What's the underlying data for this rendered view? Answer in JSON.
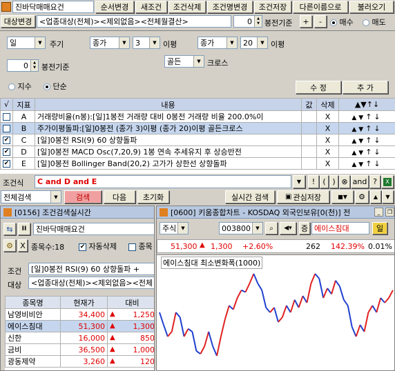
{
  "top": {
    "title_field": "진바닥매매요건",
    "buttons": [
      "순서변경",
      "새조건",
      "조건삭제",
      "조건명변경",
      "조건저장",
      "다른이름으로",
      "불러오기"
    ]
  },
  "target": {
    "label": "대상변경",
    "value": "<업종대상(전체)><제외없음><전체월결산>",
    "bong": "0",
    "bong_label": "봉전기준",
    "plus": "+",
    "minus": "-",
    "buy": "매수",
    "sell": "매도"
  },
  "settings": {
    "period": "일",
    "period_label": "주기",
    "bong": "0",
    "bong_label": "봉전기준",
    "jisu": "지수",
    "danseon": "단순",
    "ma1_type": "종가",
    "ma1_val": "3",
    "ma1_unit": "이평",
    "ma2_type": "종가",
    "ma2_val": "20",
    "ma2_unit": "이평",
    "cross_type": "골든",
    "cross_label": "크로스",
    "edit_btn": "수 정",
    "add_btn": "추 가"
  },
  "grid": {
    "headers": [
      "√",
      "지표",
      "내용",
      "값",
      "삭제",
      "▲▼↑↓"
    ],
    "rows": [
      {
        "checked": false,
        "id": "A",
        "text": "거래량비율(n봉):[일]1봉전 거래량 대비 0봉전 거래량 비율 200.0%이",
        "x": "X"
      },
      {
        "checked": false,
        "id": "B",
        "text": "주가이평돌파:[일]0봉전 (종가 3)이평 (종가 20)이평 골든크로스",
        "x": "X"
      },
      {
        "checked": true,
        "id": "C",
        "text": "[일]0봉전 RSI(9) 60 상향돌파",
        "x": "X"
      },
      {
        "checked": true,
        "id": "D",
        "text": "[일]0봉전 MACD Osc(7,20,9) 1봉 연속 추세유지 후 상승반전",
        "x": "X"
      },
      {
        "checked": true,
        "id": "E",
        "text": "[일]0봉전 Bollinger Band(20,2) 고가가 상한선 상향돌파",
        "x": "X"
      }
    ]
  },
  "formula": {
    "label": "조건식",
    "text": "C and D and E",
    "ops": [
      "!",
      "(",
      ")",
      "⊗",
      "and",
      "?"
    ]
  },
  "bottom_bar": {
    "search_type": "전체검색",
    "search": "검색",
    "next": "다음",
    "reset": "초기화",
    "realtime": "실시간 검색",
    "watch": "관심저장"
  },
  "left_win": {
    "title": "[0156] 조건검색실시간",
    "cond_name": "진바닥매매요건",
    "count_label": "종목수:18",
    "auto_delete": "자동삭제",
    "extra": "종목",
    "cond_label": "조건",
    "cond_text": "[일]0봉전 RSI(9) 60 상향돌파 +",
    "target_label": "대상",
    "target_text": "<업종대상(전체)><제외없음><전체",
    "cols": [
      "종목명",
      "현재가",
      "대비"
    ],
    "rows": [
      {
        "name": "남영비비안",
        "price": "34,400",
        "change": "1,250"
      },
      {
        "name": "에이스침대",
        "price": "51,300",
        "change": "1,300"
      },
      {
        "name": "신한",
        "price": "16,000",
        "change": "850"
      },
      {
        "name": "금비",
        "price": "36,500",
        "change": "1,000"
      },
      {
        "name": "광동제약",
        "price": "3,260",
        "change": "120"
      }
    ]
  },
  "right_win": {
    "title": "[0600] 키움종합차트 - KOSDAQ 외국인보유[0(천)] 전",
    "kind": "주식",
    "code": "003800",
    "market": "증",
    "name": "에이스침대",
    "tab": "일",
    "price": "51,300",
    "change": "1,300",
    "pct": "+2.60%",
    "volume": "262",
    "ratio": "142.39%",
    "small": "0.01%",
    "chart_label": "에이스침대 최소변화폭(1000)"
  },
  "chart_data": {
    "type": "line",
    "series": [
      {
        "values": [
          0.55,
          0.42,
          0.3,
          0.35,
          0.55,
          0.5,
          0.3,
          0.38,
          0.35,
          0.15,
          0.12,
          0.2,
          0.35,
          0.2,
          0.1,
          0.3,
          0.48,
          0.62,
          0.58,
          0.7,
          0.78,
          0.76,
          0.85,
          0.95,
          0.85,
          0.78,
          0.6,
          0.55,
          0.6,
          0.45,
          0.5,
          0.62,
          0.55,
          0.68,
          0.6,
          0.72,
          0.65,
          0.85,
          0.95,
          0.9,
          0.7,
          0.8,
          0.74,
          0.88,
          0.82,
          0.68,
          0.62,
          0.4,
          0.3,
          0.42,
          0.35,
          0.55,
          0.62,
          0.55,
          0.7,
          0.65,
          0.7,
          0.78
        ]
      }
    ]
  }
}
